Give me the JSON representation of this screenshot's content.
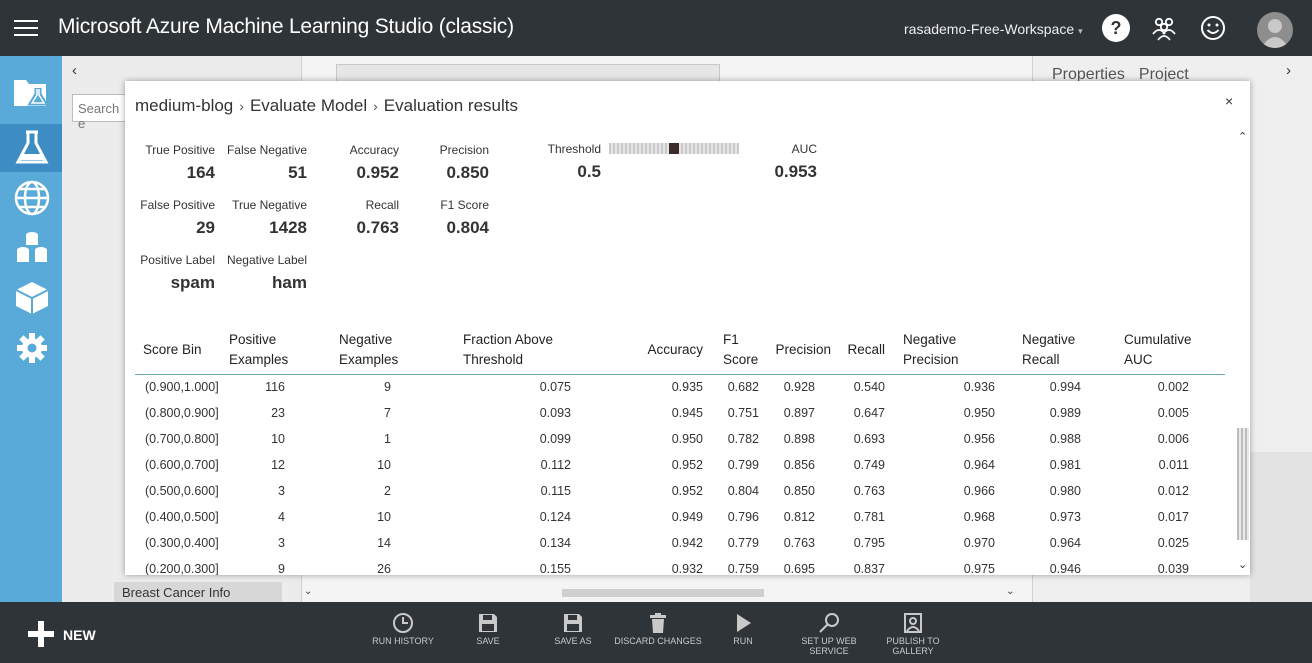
{
  "app": {
    "title": "Microsoft Azure Machine Learning Studio (classic)",
    "workspace": "rasademo-Free-Workspace",
    "help_glyph": "?",
    "workspace_caret": "▾"
  },
  "rail": {
    "items": [
      {
        "icon": "projects-icon"
      },
      {
        "icon": "experiments-icon"
      },
      {
        "icon": "web-services-icon"
      },
      {
        "icon": "datasets-icon"
      },
      {
        "icon": "trained-models-icon"
      },
      {
        "icon": "settings-icon"
      }
    ]
  },
  "palette": {
    "collapse_glyph": "‹",
    "search_placeholder": "Search e",
    "bottom_item": "Breast Cancer Info"
  },
  "properties": {
    "tabs": [
      "Properties",
      "Project"
    ],
    "arrow_glyph": "›"
  },
  "modal": {
    "breadcrumb": [
      "medium-blog",
      "Evaluate Model",
      "Evaluation results"
    ],
    "breadcrumb_sep": "›",
    "close": "×",
    "metrics": {
      "true_positive": {
        "label": "True Positive",
        "value": "164"
      },
      "false_negative": {
        "label": "False Negative",
        "value": "51"
      },
      "accuracy": {
        "label": "Accuracy",
        "value": "0.952"
      },
      "precision": {
        "label": "Precision",
        "value": "0.850"
      },
      "threshold": {
        "label": "Threshold",
        "value": "0.5"
      },
      "auc": {
        "label": "AUC",
        "value": "0.953"
      },
      "false_positive": {
        "label": "False Positive",
        "value": "29"
      },
      "true_negative": {
        "label": "True Negative",
        "value": "1428"
      },
      "recall": {
        "label": "Recall",
        "value": "0.763"
      },
      "f1_score": {
        "label": "F1 Score",
        "value": "0.804"
      },
      "positive_label": {
        "label": "Positive Label",
        "value": "spam"
      },
      "negative_label": {
        "label": "Negative Label",
        "value": "ham"
      }
    },
    "threshold_slider_value": 0.5,
    "table": {
      "headers": [
        [
          "Score Bin"
        ],
        [
          "Positive",
          "Examples"
        ],
        [
          "Negative",
          "Examples"
        ],
        [
          "Fraction Above",
          "Threshold"
        ],
        [
          "Accuracy"
        ],
        [
          "F1",
          "Score"
        ],
        [
          "Precision"
        ],
        [
          "Recall"
        ],
        [
          "Negative",
          "Precision"
        ],
        [
          "Negative",
          "Recall"
        ],
        [
          "Cumulative",
          "AUC"
        ]
      ],
      "rows": [
        [
          "(0.900,1.000]",
          "116",
          "9",
          "0.075",
          "0.935",
          "0.682",
          "0.928",
          "0.540",
          "0.936",
          "0.994",
          "0.002"
        ],
        [
          "(0.800,0.900]",
          "23",
          "7",
          "0.093",
          "0.945",
          "0.751",
          "0.897",
          "0.647",
          "0.950",
          "0.989",
          "0.005"
        ],
        [
          "(0.700,0.800]",
          "10",
          "1",
          "0.099",
          "0.950",
          "0.782",
          "0.898",
          "0.693",
          "0.956",
          "0.988",
          "0.006"
        ],
        [
          "(0.600,0.700]",
          "12",
          "10",
          "0.112",
          "0.952",
          "0.799",
          "0.856",
          "0.749",
          "0.964",
          "0.981",
          "0.011"
        ],
        [
          "(0.500,0.600]",
          "3",
          "2",
          "0.115",
          "0.952",
          "0.804",
          "0.850",
          "0.763",
          "0.966",
          "0.980",
          "0.012"
        ],
        [
          "(0.400,0.500]",
          "4",
          "10",
          "0.124",
          "0.949",
          "0.796",
          "0.812",
          "0.781",
          "0.968",
          "0.973",
          "0.017"
        ],
        [
          "(0.300,0.400]",
          "3",
          "14",
          "0.134",
          "0.942",
          "0.779",
          "0.763",
          "0.795",
          "0.970",
          "0.964",
          "0.025"
        ],
        [
          "(0.200,0.300]",
          "9",
          "26",
          "0.155",
          "0.932",
          "0.759",
          "0.695",
          "0.837",
          "0.975",
          "0.946",
          "0.039"
        ]
      ]
    }
  },
  "bottombar": {
    "new_label": "NEW",
    "commands": [
      {
        "label": "RUN HISTORY",
        "icon": "clock-icon"
      },
      {
        "label": "SAVE",
        "icon": "save-icon"
      },
      {
        "label": "SAVE AS",
        "icon": "save-as-icon"
      },
      {
        "label": "DISCARD CHANGES",
        "icon": "trash-icon"
      },
      {
        "label": "RUN",
        "icon": "play-icon"
      },
      {
        "label": "SET UP WEB\nSERVICE",
        "icon": "web-service-icon"
      },
      {
        "label": "PUBLISH TO\nGALLERY",
        "icon": "gallery-icon"
      }
    ]
  },
  "colors": {
    "topbar": "#2f3438",
    "rail": "#59a9d9",
    "rail_active": "#3d8cc4",
    "table_rule": "#6aa9a8"
  }
}
